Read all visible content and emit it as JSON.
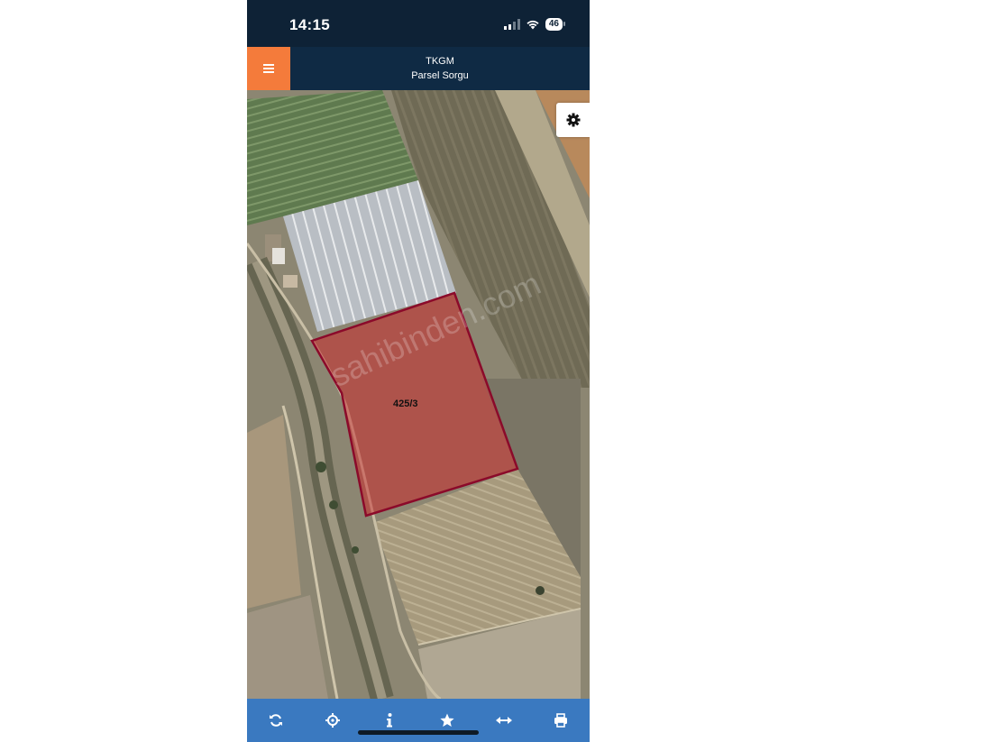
{
  "status_bar": {
    "time": "14:15",
    "battery": "46",
    "signal_icon": "cellular-signal-icon",
    "wifi_icon": "wifi-icon"
  },
  "header": {
    "title": "TKGM",
    "subtitle": "Parsel Sorgu",
    "menu_icon": "hamburger-menu-icon",
    "menu_color": "#f47b3b",
    "background": "#0f2a44"
  },
  "map": {
    "parcel_label": "425/3",
    "parcel_outline_color": "#8b0a2a",
    "parcel_fill_color": "#c83c3c",
    "watermark": "sahibinden.com",
    "settings_icon": "gear-icon"
  },
  "toolbar": {
    "background": "#3a79c0",
    "buttons": [
      {
        "icon": "refresh-icon"
      },
      {
        "icon": "locate-crosshair-icon"
      },
      {
        "icon": "info-icon"
      },
      {
        "icon": "star-icon"
      },
      {
        "icon": "measure-arrows-icon"
      },
      {
        "icon": "print-icon"
      }
    ]
  }
}
